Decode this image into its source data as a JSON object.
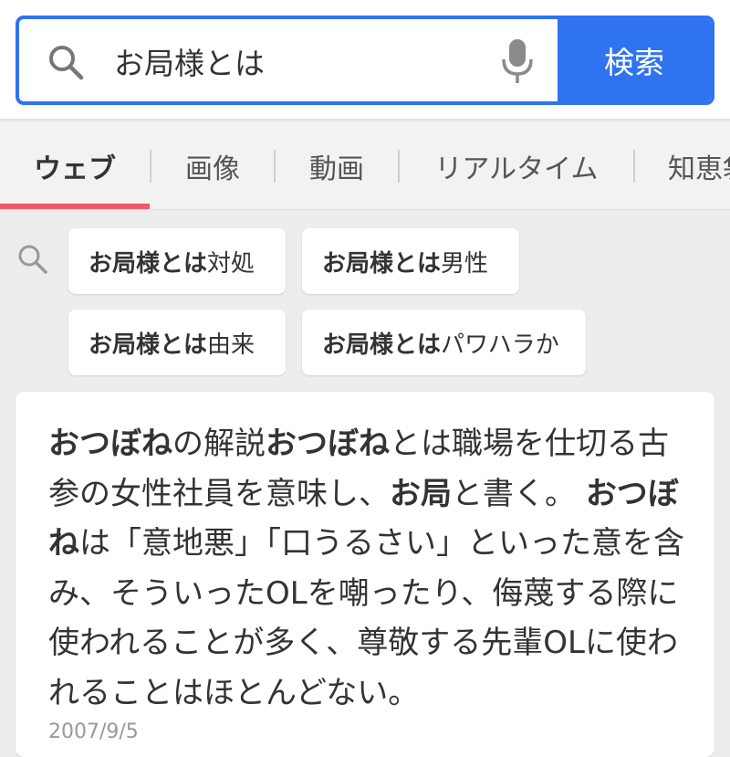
{
  "search": {
    "query": "お局様とは",
    "button_label": "検索"
  },
  "tabs": [
    {
      "label": "ウェブ",
      "active": true
    },
    {
      "label": "画像",
      "active": false
    },
    {
      "label": "動画",
      "active": false
    },
    {
      "label": "リアルタイム",
      "active": false
    },
    {
      "label": "知恵袋",
      "active": false
    }
  ],
  "related": [
    {
      "bold": "お局様とは",
      "rest": " 対処"
    },
    {
      "bold": "お局様とは",
      "rest": " 男性"
    },
    {
      "bold": "お局様とは",
      "rest": " 由来"
    },
    {
      "bold": "お局様とは",
      "rest": "パワハラか"
    }
  ],
  "result": {
    "segments": [
      {
        "text": "おつぼね",
        "bold": true
      },
      {
        "text": "の解説",
        "bold": false
      },
      {
        "text": "おつぼね",
        "bold": true
      },
      {
        "text": "とは職場を仕切る古参の女性社員を意味し、",
        "bold": false
      },
      {
        "text": "お局",
        "bold": true
      },
      {
        "text": "と書く。 ",
        "bold": false
      },
      {
        "text": "おつぼね",
        "bold": true
      },
      {
        "text": "は「意地悪」「口うるさい」といった意を含み、そういったOLを嘲ったり、侮蔑する際に使われることが多く、尊敬する先輩OLに使われることはほとんどない。",
        "bold": false
      }
    ],
    "date": "2007/9/5"
  },
  "colors": {
    "accent": "#2f73f0",
    "tab_underline": "#f0576b"
  },
  "icons": [
    "search-icon",
    "mic-icon",
    "related-search-icon"
  ]
}
